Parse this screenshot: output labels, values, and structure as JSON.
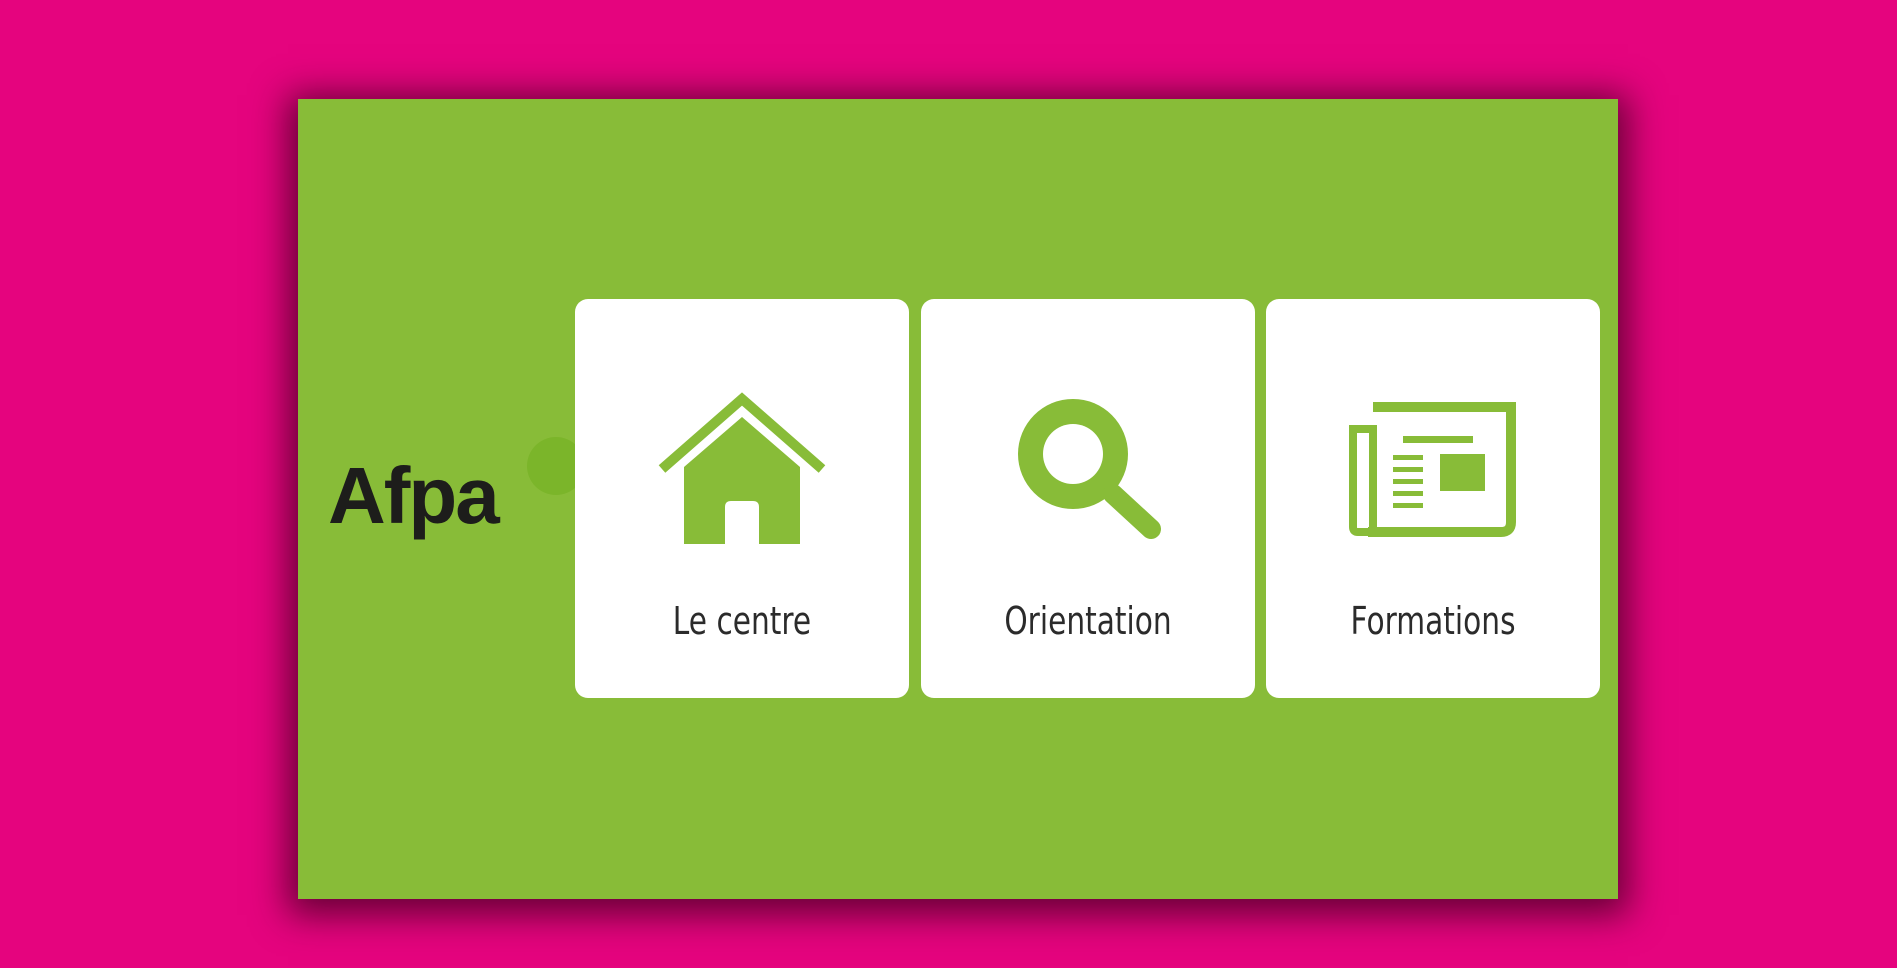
{
  "logo": {
    "text": "Afpa"
  },
  "tiles": [
    {
      "label": "Le centre",
      "icon": "home-icon"
    },
    {
      "label": "Orientation",
      "icon": "search-icon"
    },
    {
      "label": "Formations",
      "icon": "newspaper-icon"
    }
  ],
  "colors": {
    "background": "#E5047E",
    "panel": "#88BC38",
    "tile": "#FFFFFF",
    "icon": "#88BC38",
    "text": "#2B2B2B"
  }
}
